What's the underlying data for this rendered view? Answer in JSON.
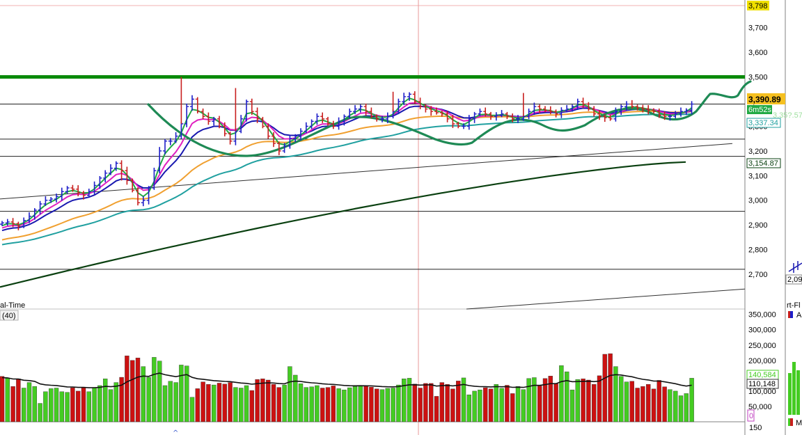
{
  "price_panel": {
    "indicator_text": "al-Time",
    "volume_period": "(40)",
    "tag_top": "3,798",
    "tag_last": "3,390.89",
    "tag_timer": "6m52s",
    "tag_hidden": "3,35?.57",
    "tag_ma_teal": "3,337.34",
    "tag_ma_long": "3,154.87",
    "side_tick": "2,09",
    "side_label": "rt-Fl",
    "side_btn": "A",
    "side_btn2": "M"
  },
  "volume_panel": {
    "tag_current": "140,584",
    "tag_avg": "110,148",
    "tag_zero": "0",
    "bottom_tick": "150"
  },
  "colors": {
    "up_bar": "#1e1ec8",
    "down_bar": "#c81e1e",
    "vol_up": "#44cc22",
    "vol_down": "#cc1111",
    "ma_green": "#22aa44",
    "ma_magenta": "#e020c0",
    "ma_blue": "#1818b0",
    "ma_orange": "#f0a030",
    "ma_teal": "#20a0a0",
    "ma_long": "#0a4010",
    "resistance": "#0a8a0a",
    "pattern": "#1e8a55"
  },
  "chart_data": [
    {
      "type": "ohlc",
      "y_ticks": [
        2700,
        2800,
        2900,
        3000,
        3100,
        3200,
        3300,
        3400,
        3500,
        3600,
        3700
      ],
      "y_tick_labels": [
        "2,700",
        "2,800",
        "2,900",
        "3,000",
        "3,100",
        "3,200",
        "3,300",
        "3,400",
        "3,500",
        "3,600",
        "3,700"
      ],
      "ylim": [
        2612,
        3810
      ],
      "resistance_level": 3500,
      "horizontal_levels": [
        3390,
        3248,
        3178,
        2955,
        2720
      ],
      "closes": [
        2908,
        2912,
        2905,
        2895,
        2918,
        2935,
        2960,
        2985,
        3000,
        3005,
        3015,
        3035,
        3050,
        3045,
        3030,
        3020,
        3035,
        3060,
        3090,
        3110,
        3130,
        3150,
        3120,
        3080,
        3040,
        2990,
        3000,
        3050,
        3120,
        3200,
        3240,
        3240,
        3260,
        3310,
        3380,
        3410,
        3360,
        3340,
        3320,
        3330,
        3300,
        3270,
        3240,
        3280,
        3330,
        3400,
        3360,
        3330,
        3300,
        3260,
        3230,
        3200,
        3220,
        3250,
        3260,
        3280,
        3300,
        3320,
        3340,
        3330,
        3310,
        3300,
        3320,
        3340,
        3360,
        3370,
        3380,
        3360,
        3340,
        3330,
        3330,
        3340,
        3360,
        3400,
        3420,
        3430,
        3400,
        3380,
        3370,
        3360,
        3355,
        3350,
        3330,
        3310,
        3300,
        3300,
        3330,
        3350,
        3360,
        3350,
        3340,
        3345,
        3350,
        3340,
        3330,
        3330,
        3340,
        3360,
        3380,
        3370,
        3365,
        3360,
        3350,
        3365,
        3370,
        3380,
        3400,
        3390,
        3370,
        3350,
        3340,
        3335,
        3330,
        3360,
        3380,
        3390,
        3380,
        3375,
        3370,
        3365,
        3360,
        3345,
        3340,
        3340,
        3350,
        3360,
        3365,
        3390
      ],
      "ma_long": {
        "start": 2648,
        "end": 3155
      },
      "trendline_upper": {
        "start": 3005,
        "end": 3230
      },
      "trendline_lower": {
        "start": 2585,
        "end": 2640
      }
    },
    {
      "type": "bar",
      "y_ticks": [
        50000,
        100000,
        150000,
        200000,
        250000,
        300000,
        350000
      ],
      "y_tick_labels": [
        "50,000",
        "100,000",
        "150,000",
        "200,000",
        "250,000",
        "300,000",
        "350,000"
      ],
      "ylim": [
        0,
        360000
      ],
      "volumes": [
        148000,
        142000,
        115000,
        140000,
        110000,
        128000,
        115000,
        60000,
        98000,
        108000,
        110000,
        98000,
        96000,
        111000,
        100000,
        112000,
        98000,
        112000,
        118000,
        140000,
        105000,
        128000,
        145000,
        215000,
        200000,
        208000,
        180000,
        145000,
        210000,
        198000,
        118000,
        132000,
        128000,
        185000,
        182000,
        80000,
        108000,
        130000,
        122000,
        120000,
        126000,
        123000,
        128000,
        112000,
        110000,
        118000,
        102000,
        138000,
        140000,
        136000,
        122000,
        112000,
        120000,
        180000,
        152000,
        124000,
        112000,
        114000,
        118000,
        110000,
        112000,
        117000,
        108000,
        104000,
        111000,
        115000,
        118000,
        116000,
        113000,
        107000,
        105000,
        109000,
        110000,
        120000,
        140000,
        142000,
        123000,
        110000,
        125000,
        125000,
        83000,
        128000,
        122000,
        107000,
        133000,
        143000,
        88000,
        100000,
        104000,
        111000,
        107000,
        122000,
        109000,
        119000,
        92000,
        115000,
        105000,
        141000,
        144000,
        117000,
        141000,
        149000,
        124000,
        183000,
        163000,
        104000,
        138000,
        140000,
        136000,
        122000,
        150000,
        220000,
        222000,
        180000,
        148000,
        130000,
        132000,
        110000,
        115000,
        122000,
        107000,
        135000,
        114000,
        105000,
        100000,
        85000,
        92000,
        142000
      ],
      "volume_ma_start": 130000,
      "volume_ma_end": 110148
    }
  ]
}
